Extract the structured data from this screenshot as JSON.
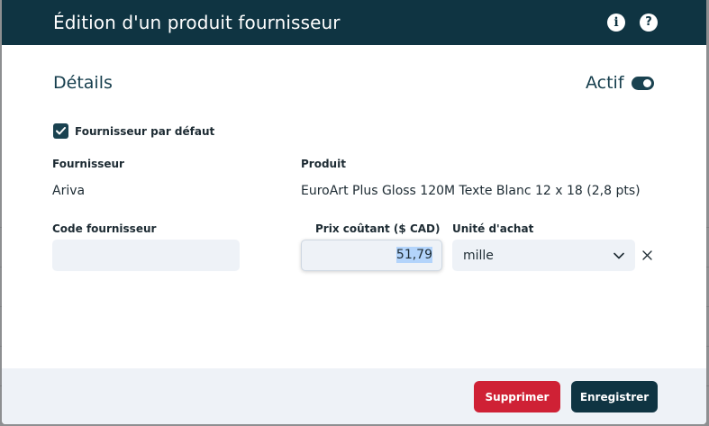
{
  "header": {
    "title": "Édition d'un produit fournisseur"
  },
  "details": {
    "section_title": "Détails",
    "active_label": "Actif",
    "active": true,
    "default_supplier_label": "Fournisseur par défaut",
    "default_supplier_checked": true
  },
  "fields": {
    "supplier_label": "Fournisseur",
    "supplier_value": "Ariva",
    "product_label": "Produit",
    "product_value": "EuroArt Plus Gloss 120M Texte Blanc 12 x 18 (2,8 pts)",
    "supplier_code_label": "Code fournisseur",
    "supplier_code_value": "",
    "cost_price_label": "Prix coûtant ($ CAD)",
    "cost_price_value": "51,79",
    "purchase_unit_label": "Unité d'achat",
    "purchase_unit_value": "mille"
  },
  "footer": {
    "delete_label": "Supprimer",
    "save_label": "Enregistrer"
  },
  "colors": {
    "header_bg": "#0f3442",
    "delete_bg": "#cf2135",
    "save_bg": "#0f3442"
  }
}
